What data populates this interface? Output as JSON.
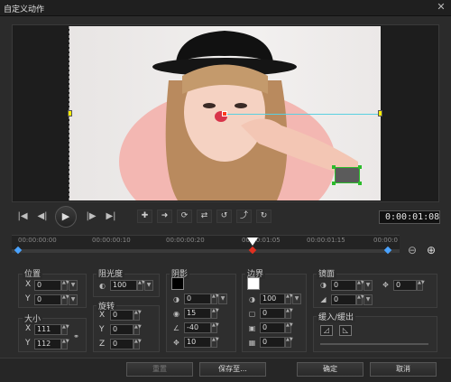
{
  "window": {
    "title": "自定义动作",
    "close_glyph": "✕"
  },
  "player": {
    "timecode": "0:00:01:08",
    "play_glyph": "▶",
    "prev_glyph": "|◀",
    "back_glyph": "◀|",
    "fwd_glyph": "|▶",
    "next_glyph": "▶|"
  },
  "tools": [
    "✚",
    "➜",
    "⟳",
    "⇄",
    "↺",
    "⤴",
    "↻"
  ],
  "ruler": {
    "ticks": [
      "00:00:00:00",
      "00:00:00:10",
      "00:00:00:20",
      "00:00:01:05",
      "00:00:01:15",
      "00:00:0"
    ],
    "zoom_out": "⊖",
    "zoom_in": "⊕"
  },
  "position": {
    "label": "位置",
    "x_label": "X",
    "x": "0",
    "y_label": "Y",
    "y": "0"
  },
  "size": {
    "label": "大小",
    "x_label": "X",
    "x": "111",
    "y_label": "Y",
    "y": "112"
  },
  "opacity": {
    "label": "阻光度",
    "value": "100"
  },
  "rotation": {
    "label": "旋转",
    "x_label": "X",
    "x": "0",
    "y_label": "Y",
    "y": "0",
    "z_label": "Z",
    "z": "0"
  },
  "shadow": {
    "label": "阴影",
    "opacity": "0",
    "blur": "15",
    "angle": "-40",
    "distance": "10",
    "color": "#000000"
  },
  "border": {
    "label": "边界",
    "opacity": "100",
    "width": "0",
    "v2": "0",
    "v3": "0",
    "color": "#ffffff"
  },
  "mirror": {
    "label": "镜面",
    "v1": "0",
    "v2": "0",
    "offset": "0"
  },
  "fade": {
    "label": "缓入/缓出"
  },
  "buttons": {
    "reset": "重置",
    "save": "保存至...",
    "ok": "确定",
    "cancel": "取消"
  }
}
